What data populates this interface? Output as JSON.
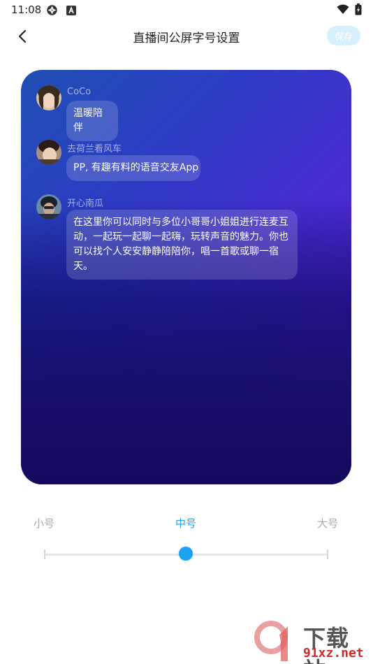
{
  "status_bar": {
    "time": "11:08",
    "left_icons": [
      "aperture-icon",
      "a-badge-icon"
    ],
    "right_icons": [
      "wifi-icon",
      "battery-icon"
    ]
  },
  "header": {
    "title": "直播间公屏字号设置",
    "save_label": "保存",
    "back_icon": "chevron-left-icon"
  },
  "preview": {
    "messages": [
      {
        "username": "CoCo",
        "text": "温暖陪伴"
      },
      {
        "username": "去荷兰看风车",
        "text": "PP, 有趣有料的语音交友App"
      },
      {
        "username": "开心南瓜",
        "text": "在这里你可以同时与多位小哥哥小姐姐进行连麦互动，一起玩一起聊一起嗨，玩转声音的魅力。你也可以找个人安安静静陪陪你，唱一首歌或聊一宿天。"
      }
    ]
  },
  "font_size": {
    "options": [
      "小号",
      "中号",
      "大号"
    ],
    "selected": "中号",
    "selected_index": 1,
    "accent_color": "#1aa3f0"
  },
  "watermark": {
    "title": "下载站",
    "subtitle": "91xz.net"
  }
}
